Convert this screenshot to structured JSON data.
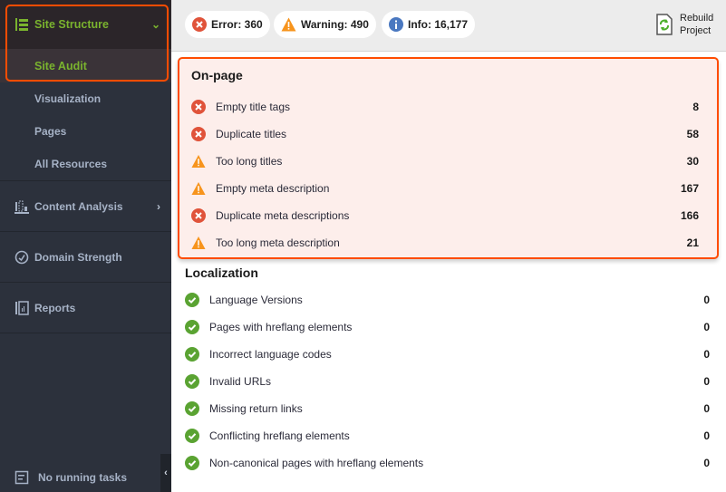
{
  "sidebar": {
    "group": {
      "label": "Site Structure",
      "icon": "site-structure-icon",
      "expanded": true
    },
    "subitems": [
      {
        "label": "Site Audit",
        "active": true
      },
      {
        "label": "Visualization"
      },
      {
        "label": "Pages"
      },
      {
        "label": "All Resources"
      }
    ],
    "items": [
      {
        "label": "Content Analysis",
        "icon": "content-analysis-icon",
        "has_arrow": true
      },
      {
        "label": "Domain Strength",
        "icon": "gauge-icon"
      },
      {
        "label": "Reports",
        "icon": "reports-icon"
      }
    ],
    "footer": {
      "label": "No running tasks",
      "icon": "tasks-icon"
    },
    "accent_color": "#7ab32e",
    "highlight_color": "#ff4c00"
  },
  "toolbar": {
    "badges": [
      {
        "type": "error",
        "label": "Error: 360",
        "color": "#e0533a"
      },
      {
        "type": "warning",
        "label": "Warning: 490",
        "color": "#f7941d"
      },
      {
        "type": "info",
        "label": "Info: 16,177",
        "color": "#4a78c0"
      }
    ],
    "rebuild": {
      "line1": "Rebuild",
      "line2": "Project"
    }
  },
  "sections": [
    {
      "title": "On-page",
      "highlighted": true,
      "rows": [
        {
          "status": "error",
          "label": "Empty title tags",
          "value": "8"
        },
        {
          "status": "error",
          "label": "Duplicate titles",
          "value": "58"
        },
        {
          "status": "warning",
          "label": "Too long titles",
          "value": "30"
        },
        {
          "status": "warning",
          "label": "Empty meta description",
          "value": "167"
        },
        {
          "status": "error",
          "label": "Duplicate meta descriptions",
          "value": "166"
        },
        {
          "status": "warning",
          "label": "Too long meta description",
          "value": "21"
        }
      ]
    },
    {
      "title": "Localization",
      "highlighted": false,
      "rows": [
        {
          "status": "ok",
          "label": "Language Versions",
          "value": "0"
        },
        {
          "status": "ok",
          "label": "Pages with hreflang elements",
          "value": "0"
        },
        {
          "status": "ok",
          "label": "Incorrect language codes",
          "value": "0"
        },
        {
          "status": "ok",
          "label": "Invalid URLs",
          "value": "0"
        },
        {
          "status": "ok",
          "label": "Missing return links",
          "value": "0"
        },
        {
          "status": "ok",
          "label": "Conflicting hreflang elements",
          "value": "0"
        },
        {
          "status": "ok",
          "label": "Non-canonical pages with hreflang elements",
          "value": "0"
        }
      ]
    }
  ]
}
